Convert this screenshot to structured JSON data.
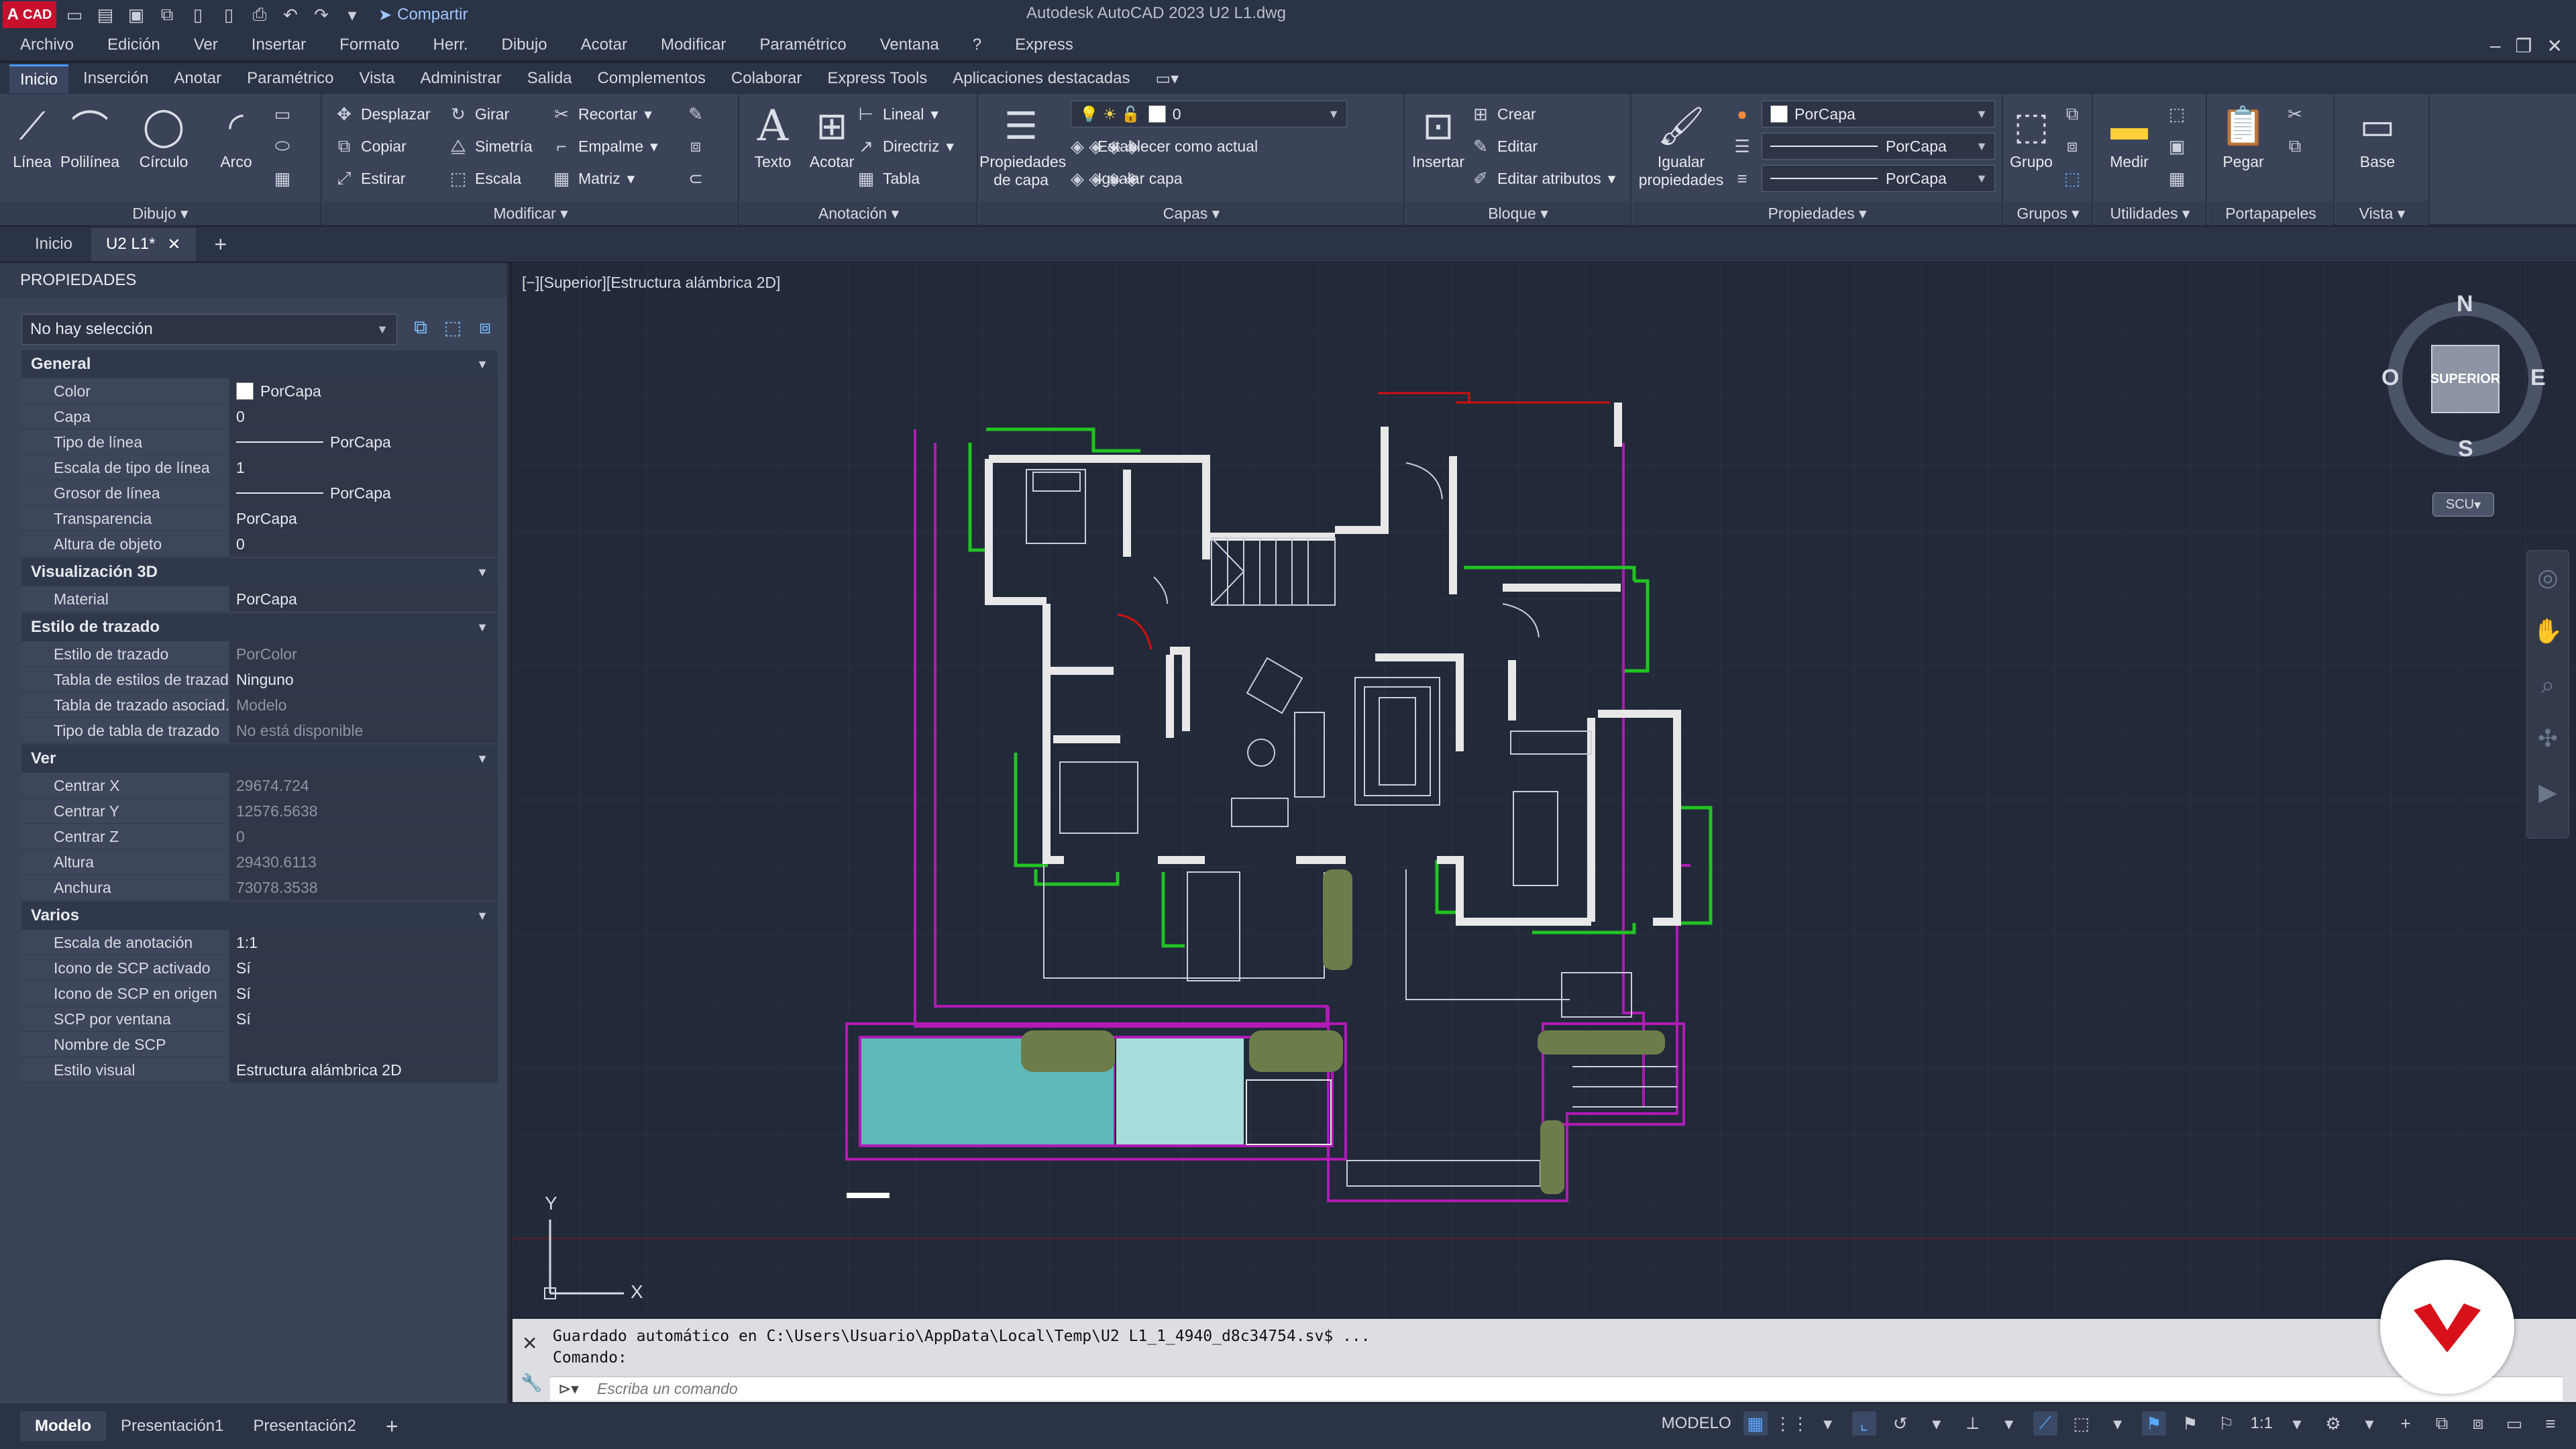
{
  "titlebar": {
    "logo_letter": "A",
    "logo_text": "CAD",
    "share_label": "Compartir",
    "window_title": "Autodesk AutoCAD 2023    U2 L1.dwg"
  },
  "menu": [
    "Archivo",
    "Edición",
    "Ver",
    "Insertar",
    "Formato",
    "Herr.",
    "Dibujo",
    "Acotar",
    "Modificar",
    "Paramétrico",
    "Ventana",
    "?",
    "Express"
  ],
  "ribbon_tabs": [
    "Inicio",
    "Inserción",
    "Anotar",
    "Paramétrico",
    "Vista",
    "Administrar",
    "Salida",
    "Complementos",
    "Colaborar",
    "Express Tools",
    "Aplicaciones destacadas"
  ],
  "ribbon": {
    "draw": {
      "title": "Dibujo",
      "line": "Línea",
      "polyline": "Polilínea",
      "circle": "Círculo",
      "arc": "Arco"
    },
    "modify": {
      "title": "Modificar",
      "move": "Desplazar",
      "rotate": "Girar",
      "trim": "Recortar",
      "copy": "Copiar",
      "mirror": "Simetría",
      "fillet": "Empalme",
      "stretch": "Estirar",
      "scale": "Escala",
      "array": "Matriz"
    },
    "annotation": {
      "title": "Anotación",
      "text": "Texto",
      "dimension": "Acotar",
      "linear": "Lineal",
      "leader": "Directriz",
      "table": "Tabla"
    },
    "layers": {
      "title": "Capas",
      "layer_props_1": "Propiedades",
      "layer_props_2": "de capa",
      "current_layer": "0",
      "set_current": "Establecer como actual",
      "match_layer": "Igualar capa"
    },
    "block": {
      "title": "Bloque",
      "insert": "Insertar",
      "create": "Crear",
      "edit": "Editar",
      "edit_attributes": "Editar atributos"
    },
    "properties": {
      "title": "Propiedades",
      "match_1": "Igualar",
      "match_2": "propiedades",
      "color": "PorCapa",
      "linetype": "PorCapa",
      "lineweight": "PorCapa"
    },
    "groups": {
      "title": "Grupos",
      "group": "Grupo"
    },
    "utilities": {
      "title": "Utilidades",
      "measure": "Medir"
    },
    "clipboard": {
      "title": "Portapapeles",
      "paste": "Pegar"
    },
    "view": {
      "title": "Vista",
      "base": "Base"
    }
  },
  "doc_tabs": {
    "home": "Inicio",
    "current": "U2 L1*"
  },
  "properties_palette": {
    "title": "PROPIEDADES",
    "selection": "No hay selección",
    "sections": [
      {
        "title": "General",
        "rows": [
          {
            "name": "Color",
            "value": "PorCapa"
          },
          {
            "name": "Capa",
            "value": "0"
          },
          {
            "name": "Tipo de línea",
            "value": "PorCapa"
          },
          {
            "name": "Escala de tipo de línea",
            "value": "1"
          },
          {
            "name": "Grosor de línea",
            "value": "PorCapa"
          },
          {
            "name": "Transparencia",
            "value": "PorCapa"
          },
          {
            "name": "Altura de objeto",
            "value": "0"
          }
        ]
      },
      {
        "title": "Visualización 3D",
        "rows": [
          {
            "name": "Material",
            "value": "PorCapa"
          }
        ]
      },
      {
        "title": "Estilo de trazado",
        "rows": [
          {
            "name": "Estilo de trazado",
            "value": "PorColor"
          },
          {
            "name": "Tabla de estilos de trazado",
            "value": "Ninguno"
          },
          {
            "name": "Tabla de trazado asociad...",
            "value": "Modelo"
          },
          {
            "name": "Tipo de tabla de trazado",
            "value": "No está disponible"
          }
        ]
      },
      {
        "title": "Ver",
        "rows": [
          {
            "name": "Centrar X",
            "value": "29674.724"
          },
          {
            "name": "Centrar Y",
            "value": "12576.5638"
          },
          {
            "name": "Centrar Z",
            "value": "0"
          },
          {
            "name": "Altura",
            "value": "29430.6113"
          },
          {
            "name": "Anchura",
            "value": "73078.3538"
          }
        ]
      },
      {
        "title": "Varios",
        "rows": [
          {
            "name": "Escala de anotación",
            "value": "1:1"
          },
          {
            "name": "Icono de SCP activado",
            "value": "Sí"
          },
          {
            "name": "Icono de SCP en origen",
            "value": "Sí"
          },
          {
            "name": "SCP por ventana",
            "value": "Sí"
          },
          {
            "name": "Nombre de SCP",
            "value": ""
          },
          {
            "name": "Estilo visual",
            "value": "Estructura alámbrica 2D"
          }
        ]
      }
    ]
  },
  "viewport": {
    "label": "[−][Superior][Estructura alámbrica 2D]",
    "viewcube_face": "SUPERIOR",
    "compass_n": "N",
    "compass_s": "S",
    "compass_e": "E",
    "compass_w": "O",
    "ucs_button": "SCU",
    "ucs_x": "X",
    "ucs_y": "Y"
  },
  "command_line": {
    "history_1": "Guardado automático en C:\\Users\\Usuario\\AppData\\Local\\Temp\\U2 L1_1_4940_d8c34754.sv$ ...",
    "history_2": "Comando:",
    "placeholder": "Escriba un comando"
  },
  "status": {
    "layout_tabs": [
      "Modelo",
      "Presentación1",
      "Presentación2"
    ],
    "mode": "MODELO",
    "scale": "1:1"
  },
  "colors": {
    "accent": "#4a9bff",
    "wall": "#e8e8e8",
    "green_layer": "#22c322",
    "purple_layer": "#b01bb5",
    "pool": "#5fb9b9",
    "red_layer": "#d01010"
  }
}
